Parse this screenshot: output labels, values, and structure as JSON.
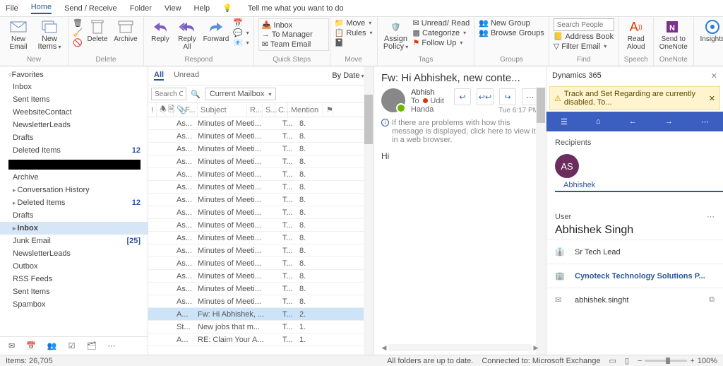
{
  "menubar": {
    "items": [
      "File",
      "Home",
      "Send / Receive",
      "Folder",
      "View",
      "Help"
    ],
    "tellme": "Tell me what you want to do"
  },
  "ribbon": {
    "new_email": "New\nEmail",
    "new_items": "New\nItems",
    "delete": "Delete",
    "archive": "Archive",
    "reply": "Reply",
    "reply_all": "Reply\nAll",
    "forward": "Forward",
    "inbox": "Inbox",
    "to_manager": "To Manager",
    "team_email": "Team Email",
    "move": "Move",
    "rules": "Rules",
    "assign_policy": "Assign\nPolicy",
    "unread": "Unread/ Read",
    "categorize": "Categorize",
    "followup": "Follow Up",
    "new_group": "New Group",
    "browse_groups": "Browse Groups",
    "search_placeholder": "Search People",
    "address_book": "Address Book",
    "filter_email": "Filter Email",
    "read_aloud": "Read\nAloud",
    "onenote": "Send to\nOneNote",
    "insights": "Insights",
    "dynamics": "Dynamics\n365",
    "groups": {
      "new": "New",
      "delete": "Delete",
      "respond": "Respond",
      "quicksteps": "Quick Steps",
      "move": "Move",
      "tags": "Tags",
      "groups": "Groups",
      "find": "Find",
      "speech": "Speech",
      "onenote": "OneNote"
    }
  },
  "nav": {
    "fav_label": "Favorites",
    "fav": [
      {
        "label": "Inbox"
      },
      {
        "label": "Sent Items"
      },
      {
        "label": "WeebsiteContact"
      },
      {
        "label": "NewsletterLeads"
      },
      {
        "label": "Drafts"
      },
      {
        "label": "Deleted Items",
        "count": "12"
      }
    ],
    "tree": [
      {
        "label": "Archive"
      },
      {
        "label": "Conversation History",
        "caret": true
      },
      {
        "label": "Deleted Items",
        "caret": true,
        "count": "12"
      },
      {
        "label": "Drafts"
      },
      {
        "label": "Inbox",
        "caret": true,
        "selected": true
      },
      {
        "label": "Junk Email",
        "count": "[25]"
      },
      {
        "label": "NewsletterLeads"
      },
      {
        "label": "Outbox"
      },
      {
        "label": "RSS Feeds"
      },
      {
        "label": "Sent Items"
      },
      {
        "label": "Spambox"
      }
    ]
  },
  "list": {
    "tabs": {
      "all": "All",
      "unread": "Unread"
    },
    "search_placeholder": "Search C",
    "mailbox": "Current Mailbox",
    "sort": "By Date",
    "cols": {
      "from": "F...",
      "subject": "Subject",
      "r": "R...",
      "s": "S...",
      "c": "C...",
      "mention": "Mention"
    },
    "rows": [
      {
        "a": "As...",
        "b": "Minutes of Meeti...",
        "c": "T...",
        "d": "8."
      },
      {
        "a": "As...",
        "b": "Minutes of Meeti...",
        "c": "T...",
        "d": "8."
      },
      {
        "a": "As...",
        "b": "Minutes of Meeti...",
        "c": "T...",
        "d": "8."
      },
      {
        "a": "As...",
        "b": "Minutes of Meeti...",
        "c": "T...",
        "d": "8."
      },
      {
        "a": "As...",
        "b": "Minutes of Meeti...",
        "c": "T...",
        "d": "8."
      },
      {
        "a": "As...",
        "b": "Minutes of Meeti...",
        "c": "T...",
        "d": "8."
      },
      {
        "a": "As...",
        "b": "Minutes of Meeti...",
        "c": "T...",
        "d": "8."
      },
      {
        "a": "As...",
        "b": "Minutes of Meeti...",
        "c": "T...",
        "d": "8."
      },
      {
        "a": "As...",
        "b": "Minutes of Meeti...",
        "c": "T...",
        "d": "8."
      },
      {
        "a": "As...",
        "b": "Minutes of Meeti...",
        "c": "T...",
        "d": "8."
      },
      {
        "a": "As...",
        "b": "Minutes of Meeti...",
        "c": "T...",
        "d": "8."
      },
      {
        "a": "As...",
        "b": "Minutes of Meeti...",
        "c": "T...",
        "d": "8."
      },
      {
        "a": "As...",
        "b": "Minutes of Meeti...",
        "c": "T...",
        "d": "8."
      },
      {
        "a": "As...",
        "b": "Minutes of Meeti...",
        "c": "T...",
        "d": "8."
      },
      {
        "a": "As...",
        "b": "Minutes of Meeti...",
        "c": "T...",
        "d": "8."
      },
      {
        "a": "A...",
        "b": "Fw: Hi Abhishek, ...",
        "c": "T...",
        "d": "2.",
        "sel": true
      },
      {
        "a": "St...",
        "b": "New jobs that m...",
        "c": "T...",
        "d": "1."
      },
      {
        "a": "A...",
        "b": "RE: Claim Your A...",
        "c": "T...",
        "d": "1."
      }
    ]
  },
  "reader": {
    "subject": "Fw: Hi Abhishek, new conte...",
    "from": "Abhish",
    "to_label": "To",
    "to_name": "Udit Handa",
    "time": "Tue 6:17 PM",
    "info": "If there are problems with how this message is displayed, click here to view it in a web browser.",
    "body": "Hi"
  },
  "d365": {
    "title": "Dynamics 365",
    "warn": "Track and Set Regarding are currently disabled. To...",
    "recipients": "Recipients",
    "initials": "AS",
    "recipient_name": "Abhishek",
    "user_label": "User",
    "user_name": "Abhishek Singh",
    "role": "Sr Tech Lead",
    "company": "Cynoteck Technology Solutions P...",
    "email": "abhishek.singht"
  },
  "status": {
    "items": "Items: 26,705",
    "folders": "All folders are up to date.",
    "connected": "Connected to: Microsoft Exchange",
    "zoom": "100%"
  }
}
